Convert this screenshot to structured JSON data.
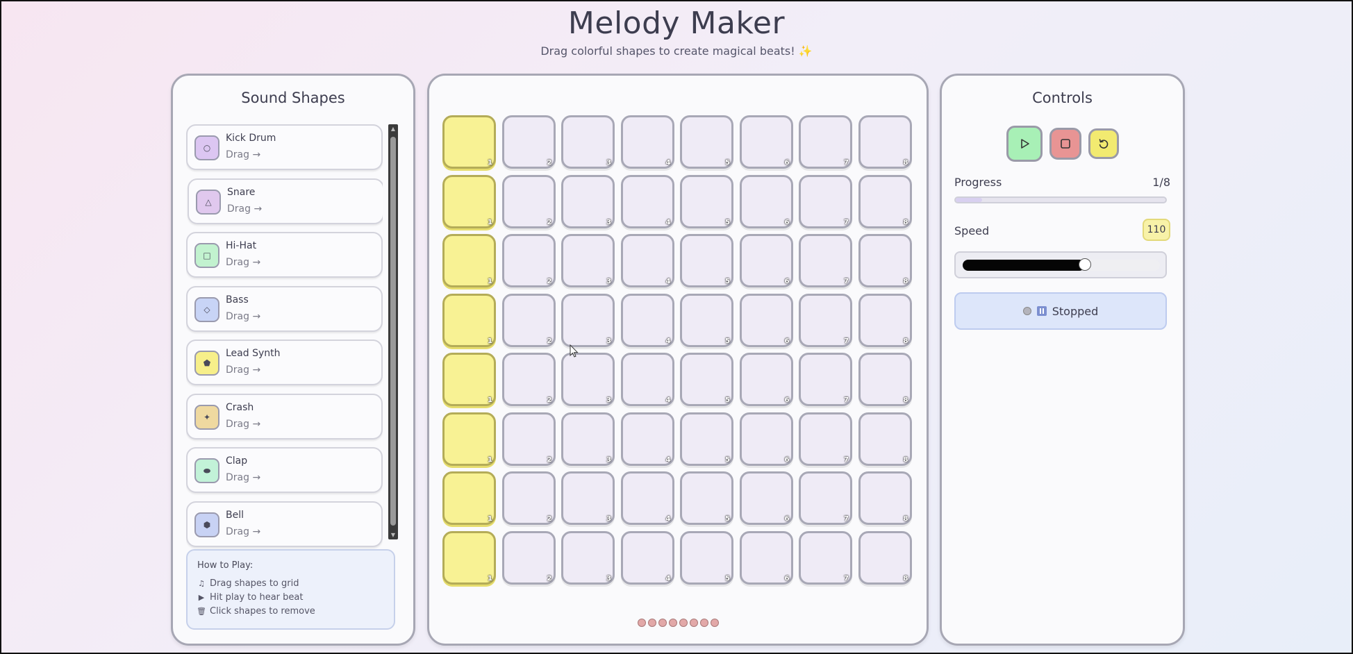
{
  "header": {
    "title": "Melody Maker",
    "subtitle": "Drag colorful shapes to create magical beats! ✨"
  },
  "sound_panel": {
    "title": "Sound Shapes",
    "items": [
      {
        "name": "Kick Drum",
        "drag": "Drag →",
        "icon": "circle-icon",
        "glyph": "○",
        "color": "#dcc6f2"
      },
      {
        "name": "Snare",
        "drag": "Drag →",
        "icon": "triangle-icon",
        "glyph": "△",
        "color": "#e0c8ee"
      },
      {
        "name": "Hi-Hat",
        "drag": "Drag →",
        "icon": "square-icon",
        "glyph": "□",
        "color": "#c2f2cf"
      },
      {
        "name": "Bass",
        "drag": "Drag →",
        "icon": "diamond-icon",
        "glyph": "◇",
        "color": "#c8d4f6"
      },
      {
        "name": "Lead Synth",
        "drag": "Drag →",
        "icon": "pentagon-icon",
        "glyph": "⬟",
        "color": "#f7ef8a"
      },
      {
        "name": "Crash",
        "drag": "Drag →",
        "icon": "star-icon",
        "glyph": "✦",
        "color": "#efd9a0"
      },
      {
        "name": "Clap",
        "drag": "Drag →",
        "icon": "pill-icon",
        "glyph": "⬬",
        "color": "#c2f2d8"
      },
      {
        "name": "Bell",
        "drag": "Drag →",
        "icon": "hexagon-icon",
        "glyph": "⬢",
        "color": "#c8d2f4"
      }
    ],
    "howto": {
      "title": "How to Play:",
      "lines": [
        {
          "icon": "music-note-icon",
          "glyph": "♫",
          "text": "Drag shapes to grid"
        },
        {
          "icon": "play-icon",
          "glyph": "▶",
          "text": "Hit play to hear beat"
        },
        {
          "icon": "trash-icon",
          "glyph": "🗑",
          "text": "Click shapes to remove"
        }
      ]
    }
  },
  "grid": {
    "rows": 8,
    "columns": [
      "1",
      "2",
      "3",
      "4",
      "5",
      "6",
      "7",
      "8"
    ],
    "active_column": 1,
    "step_dots": 8
  },
  "controls": {
    "title": "Controls",
    "play_icon": "play-icon",
    "stop_icon": "stop-icon",
    "reset_icon": "reset-icon",
    "progress_label": "Progress",
    "progress_value": "1/8",
    "progress_fraction": 0.125,
    "speed_label": "Speed",
    "speed_value": "110",
    "speed_fraction": 0.62,
    "status_text": "Stopped"
  }
}
